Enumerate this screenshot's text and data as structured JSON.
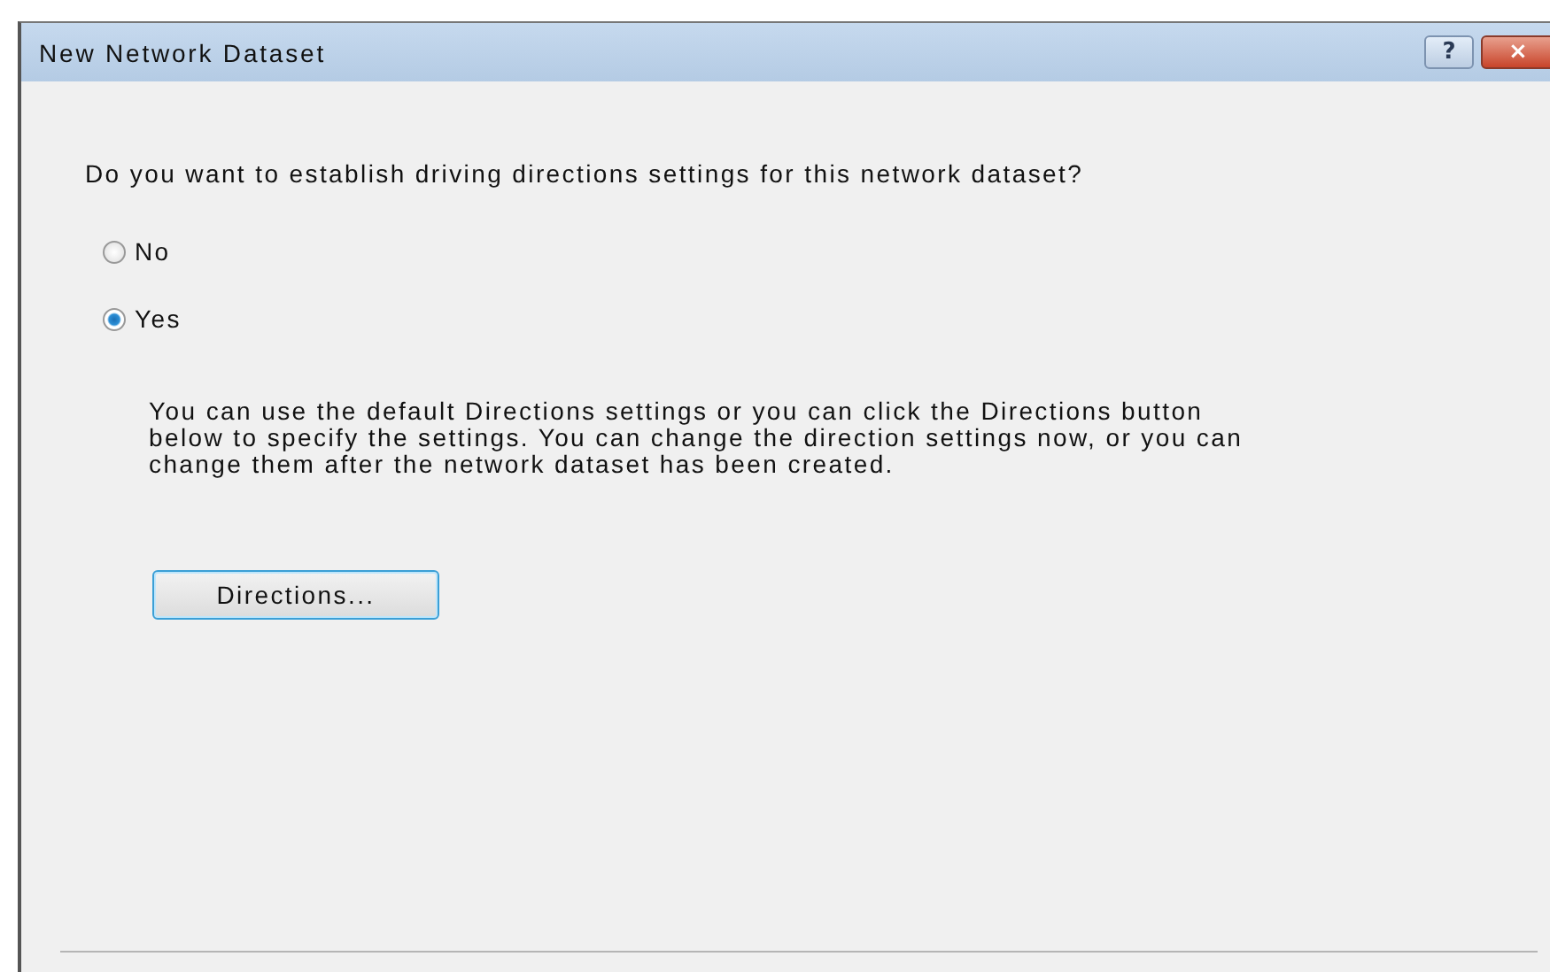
{
  "window": {
    "title": "New Network Dataset",
    "help_button": "?",
    "close_button": "×"
  },
  "question": "Do you want to establish driving directions settings for this network dataset?",
  "options": [
    {
      "label": "No",
      "selected": false
    },
    {
      "label": "Yes",
      "selected": true
    }
  ],
  "description": "You can use the default Directions settings or you can click the Directions button below to specify the settings. You can change the direction settings now, or you can change them after the network dataset has been created.",
  "directions_button": "Directions..."
}
